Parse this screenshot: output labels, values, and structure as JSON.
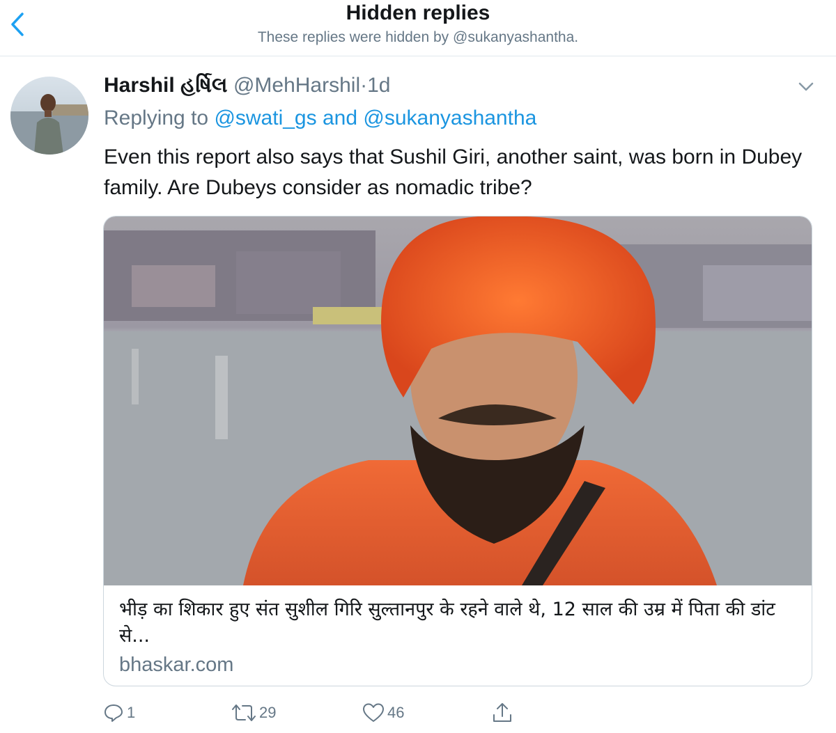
{
  "header": {
    "title": "Hidden replies",
    "subtitle": "These replies were hidden by @sukanyashantha.",
    "back_icon": "chevron-left-icon",
    "accent": "#1da1f2"
  },
  "tweet": {
    "author_name": "Harshil હર્ષિલ",
    "handle": "@MehHarshil",
    "separator": "·",
    "time": "1d",
    "replying_prefix": "Replying to",
    "reply_user_1": "@swati_gs",
    "reply_and": "and",
    "reply_user_2": "@sukanyashantha",
    "text": "Even this report also says that Sushil Giri, another saint, was born in Dubey family. Are Dubeys consider as nomadic tribe?",
    "link_color": "#1b95e0"
  },
  "card": {
    "title": "भीड़ का शिकार हुए संत सुशील गिरि सुल्तानपुर के रहने वाले थे, 12 साल की उम्र में पिता की डांट से...",
    "domain": "bhaskar.com"
  },
  "actions": {
    "reply_count": "1",
    "retweet_count": "29",
    "like_count": "46"
  }
}
